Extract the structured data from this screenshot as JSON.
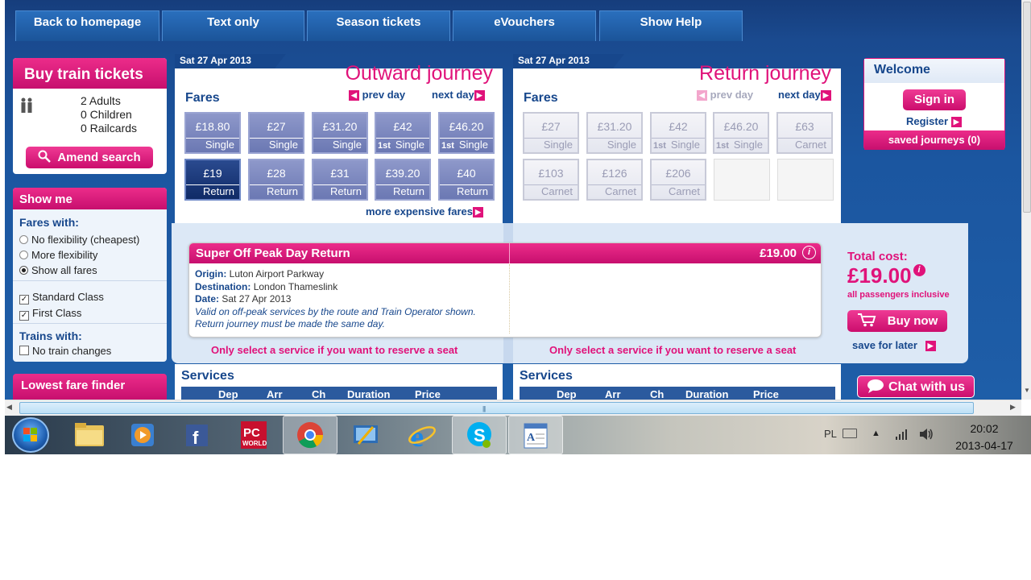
{
  "nav": [
    "Back to homepage",
    "Text only",
    "Season tickets",
    "eVouchers",
    "Show Help"
  ],
  "buy": {
    "title": "Buy train tickets",
    "passengers": [
      "2 Adults",
      "0 Children",
      "0 Railcards"
    ],
    "amend_label": "Amend search"
  },
  "show_me": {
    "title": "Show me",
    "fares_with_label": "Fares with:",
    "options": [
      "No flexibility (cheapest)",
      "More flexibility",
      "Show all fares"
    ],
    "selected_option": "Show all fares",
    "standard_class": "Standard Class",
    "first_class": "First Class",
    "trains_with_label": "Trains with:",
    "no_changes": "No train changes"
  },
  "lowest_fare_finder": "Lowest fare finder",
  "outward": {
    "date": "Sat 27 Apr 2013",
    "title": "Outward journey",
    "fares_label": "Fares",
    "prev_day": "prev day",
    "next_day": "next day",
    "more_expensive": "more expensive fares",
    "fares_row1": [
      {
        "price": "£18.80",
        "type": "Single",
        "first": ""
      },
      {
        "price": "£27",
        "type": "Single",
        "first": ""
      },
      {
        "price": "£31.20",
        "type": "Single",
        "first": ""
      },
      {
        "price": "£42",
        "type": "Single",
        "first": "1st"
      },
      {
        "price": "£46.20",
        "type": "Single",
        "first": "1st"
      }
    ],
    "fares_row2": [
      {
        "price": "£19",
        "type": "Return",
        "first": ""
      },
      {
        "price": "£28",
        "type": "Return",
        "first": ""
      },
      {
        "price": "£31",
        "type": "Return",
        "first": ""
      },
      {
        "price": "£39.20",
        "type": "Return",
        "first": ""
      },
      {
        "price": "£40",
        "type": "Return",
        "first": ""
      }
    ]
  },
  "return": {
    "date": "Sat 27 Apr 2013",
    "title": "Return journey",
    "fares_label": "Fares",
    "prev_day": "prev day",
    "next_day": "next day",
    "fares_row1": [
      {
        "price": "£27",
        "type": "Single",
        "first": ""
      },
      {
        "price": "£31.20",
        "type": "Single",
        "first": ""
      },
      {
        "price": "£42",
        "type": "Single",
        "first": "1st"
      },
      {
        "price": "£46.20",
        "type": "Single",
        "first": "1st"
      },
      {
        "price": "£63",
        "type": "Carnet",
        "first": ""
      }
    ],
    "fares_row2": [
      {
        "price": "£103",
        "type": "Carnet",
        "first": ""
      },
      {
        "price": "£126",
        "type": "Carnet",
        "first": ""
      },
      {
        "price": "£206",
        "type": "Carnet",
        "first": ""
      }
    ]
  },
  "ticket": {
    "name": "Super Off Peak Day Return",
    "price": "£19.00",
    "origin_label": "Origin:",
    "origin": "Luton Airport Parkway",
    "destination_label": "Destination:",
    "destination": "London Thameslink",
    "date_label": "Date:",
    "date": "Sat 27 Apr 2013",
    "note": "Valid on off-peak services by the route and Train Operator shown. Return journey must be made the same day."
  },
  "reserve_note": "Only select a service if you want to reserve a seat",
  "total": {
    "label": "Total cost:",
    "amount": "£19.00",
    "inclusive": "all passengers inclusive",
    "buy_now": "Buy now",
    "save_later": "save for later"
  },
  "welcome": {
    "title": "Welcome",
    "sign_in": "Sign in",
    "register": "Register",
    "saved": "saved journeys (0)"
  },
  "services": {
    "title": "Services",
    "columns": [
      "Dep",
      "Arr",
      "Ch",
      "Duration",
      "Price"
    ]
  },
  "chat": "Chat with us",
  "taskbar": {
    "lang": "PL",
    "time": "20:02",
    "date": "2013-04-17"
  },
  "colors": {
    "brand_pink": "#e0127a",
    "navy": "#17478c"
  }
}
